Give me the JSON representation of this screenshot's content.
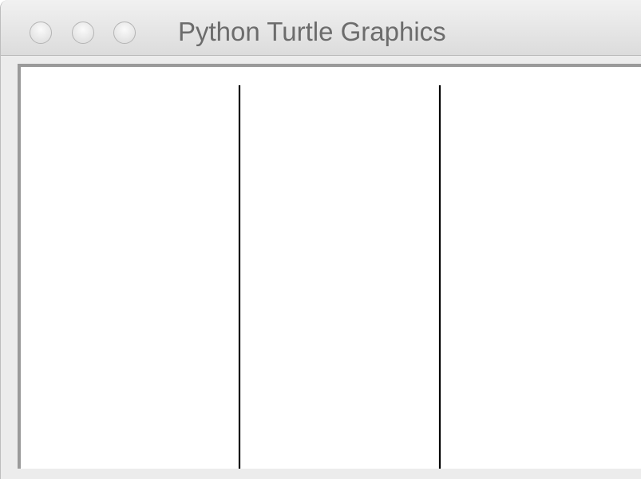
{
  "window": {
    "title": "Python Turtle Graphics",
    "controls": [
      {
        "name": "close",
        "icon": "close-traffic-light-icon"
      },
      {
        "name": "minimize",
        "icon": "minimize-traffic-light-icon"
      },
      {
        "name": "zoom",
        "icon": "zoom-traffic-light-icon"
      }
    ]
  },
  "canvas": {
    "background": "#ffffff",
    "stroke_color": "#000000",
    "lines": [
      {
        "name": "turtle-line-1",
        "orientation": "vertical"
      },
      {
        "name": "turtle-line-2",
        "orientation": "vertical"
      }
    ]
  }
}
